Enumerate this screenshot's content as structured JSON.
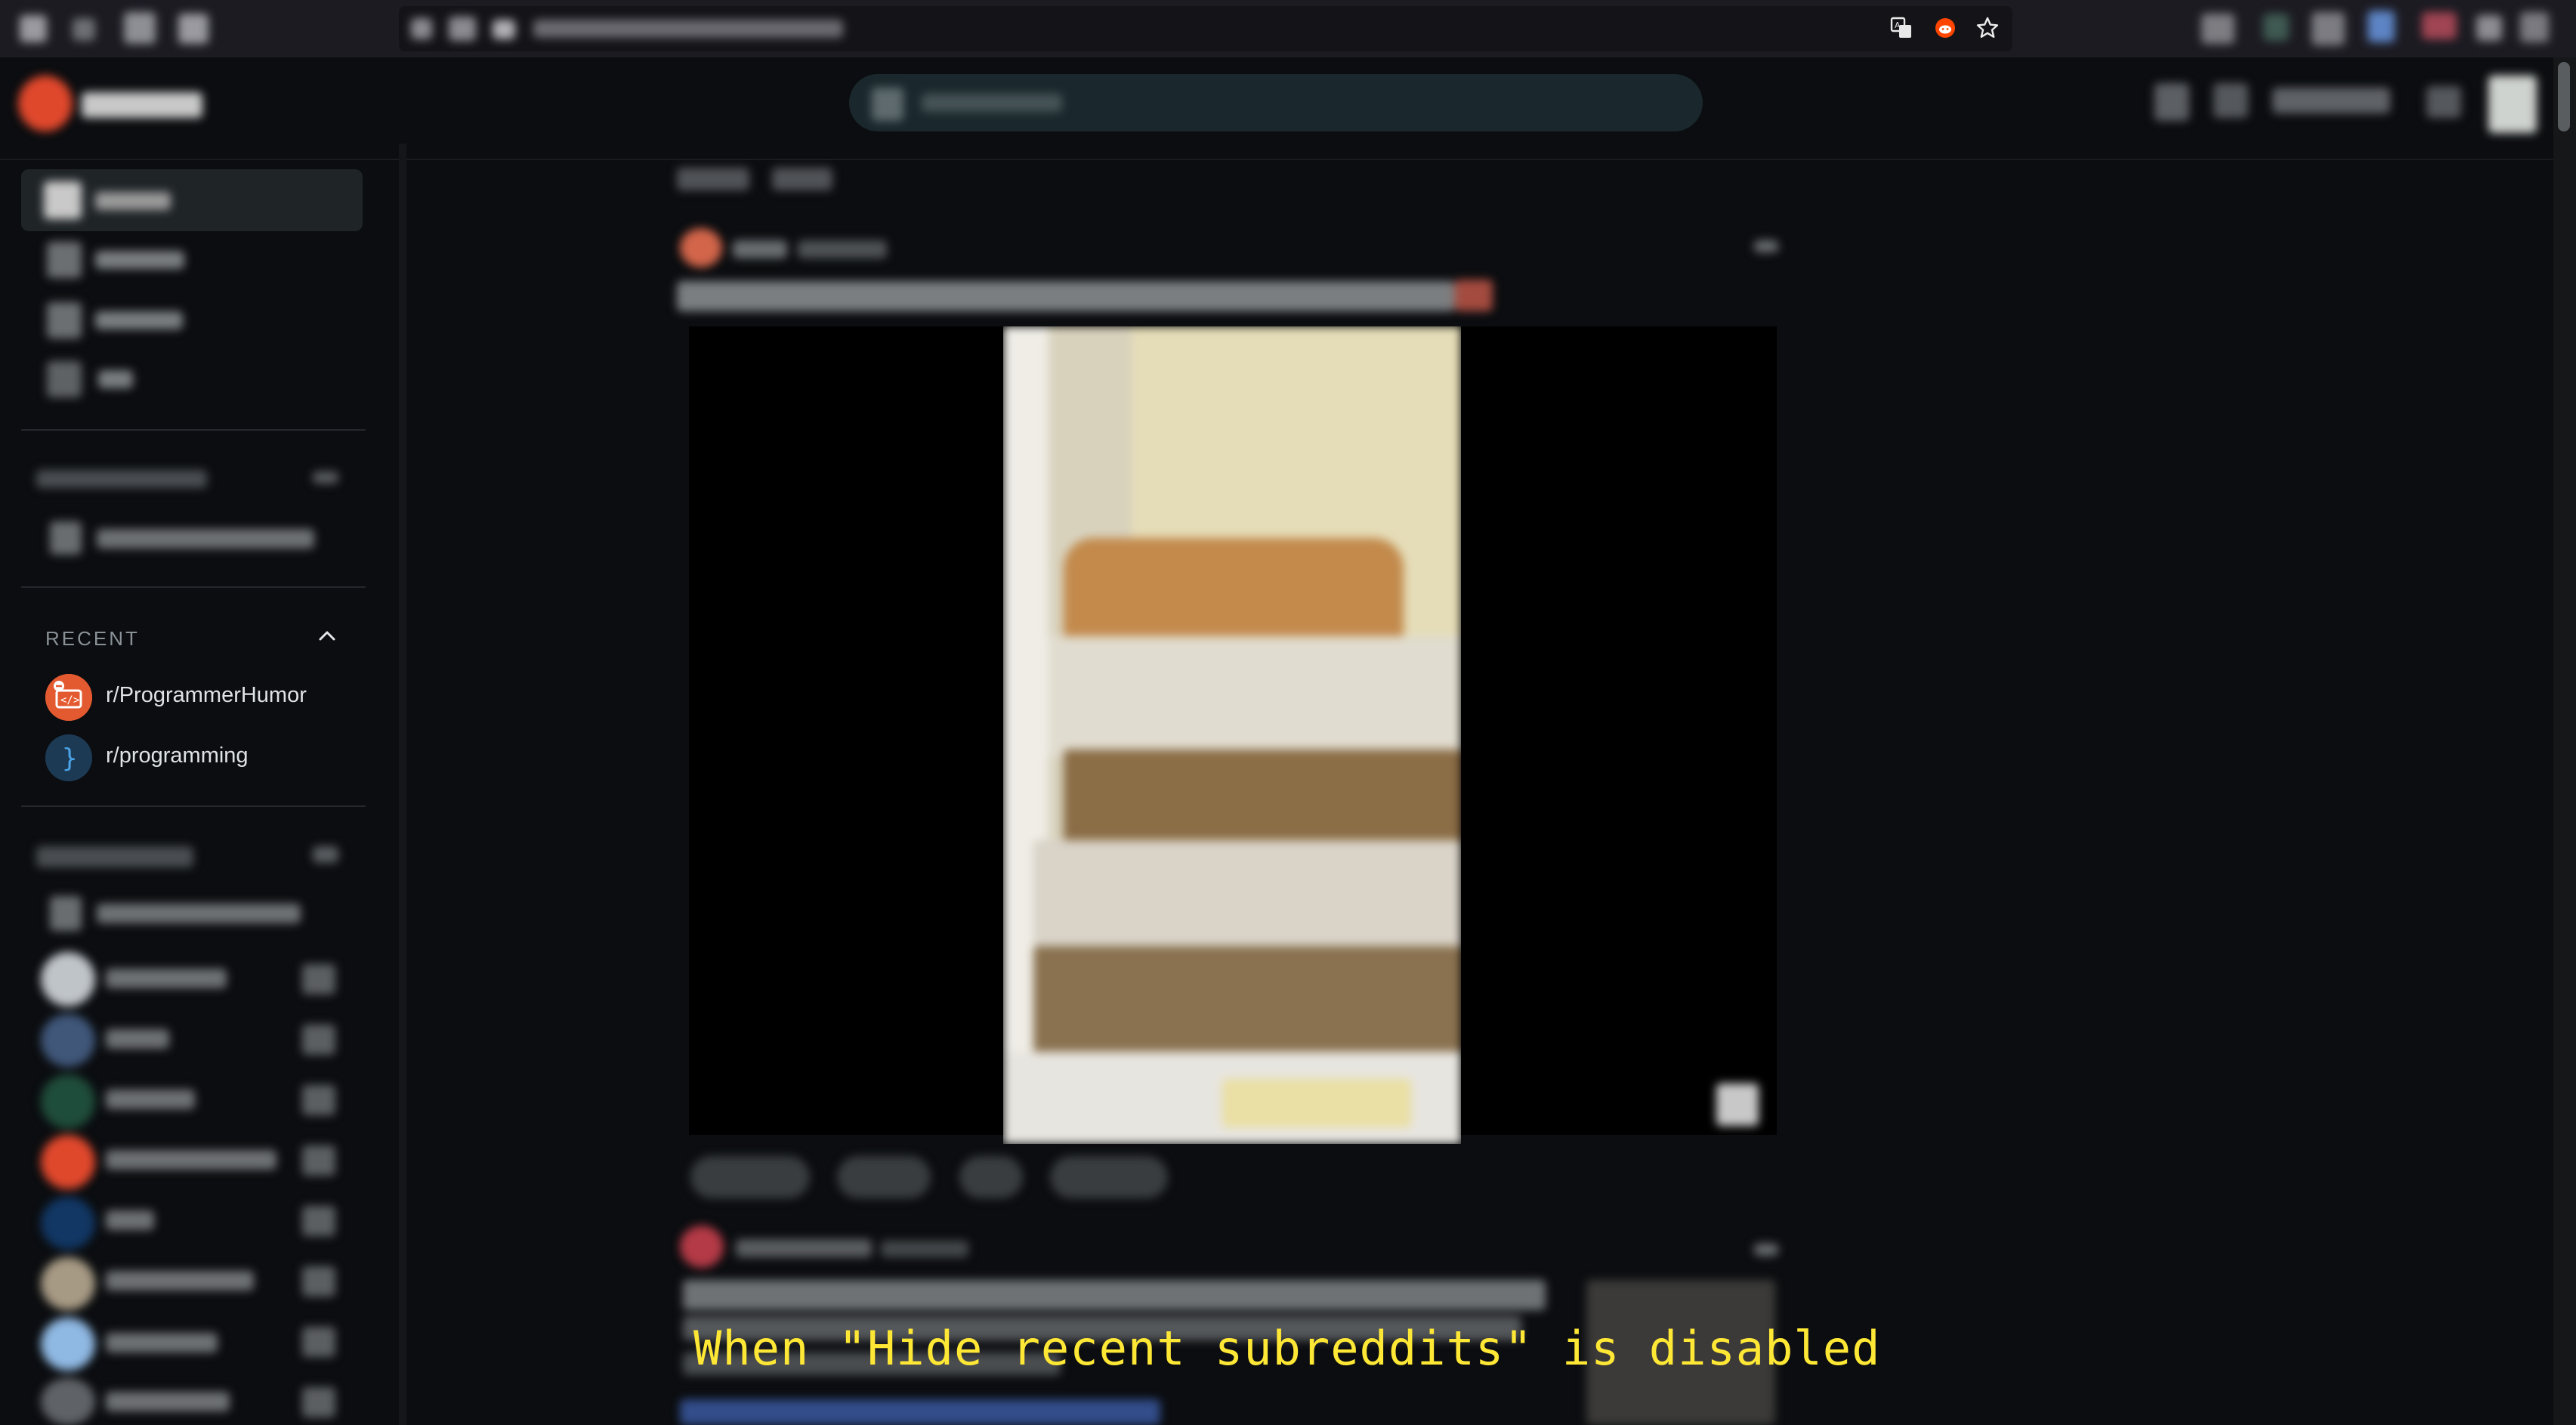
{
  "recent_section": {
    "label": "RECENT",
    "items": [
      {
        "label": "r/ProgrammerHumor",
        "icon": "programmerhumor-avatar",
        "color": "#e45a30"
      },
      {
        "label": "r/programming",
        "icon": "programming-avatar",
        "color": "#1d3a55"
      }
    ]
  },
  "caption": "When \"Hide recent subreddits\" is disabled",
  "colors": {
    "page_bg": "#0b0d10",
    "caption": "#ffe835",
    "reddit_orange": "#ff4500"
  }
}
